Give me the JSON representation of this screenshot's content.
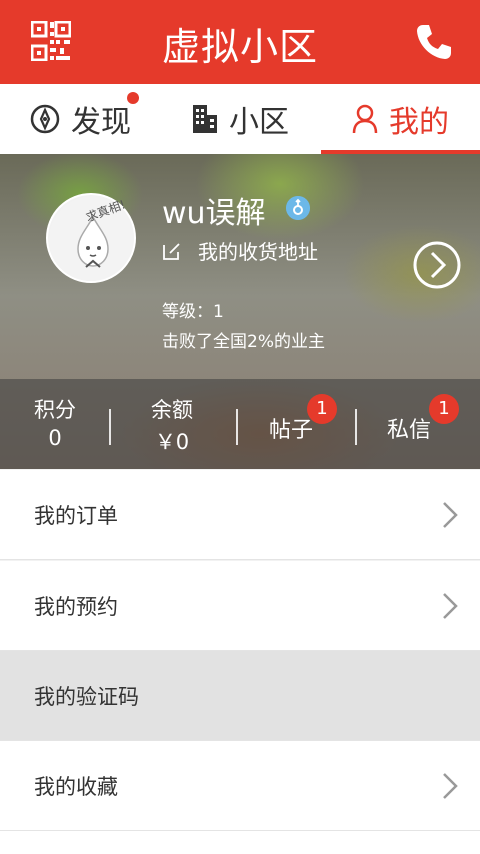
{
  "header": {
    "title": "虚拟小区",
    "left_icon": "qr-code-icon",
    "right_icon": "phone-icon"
  },
  "tabs": [
    {
      "label": "发现",
      "icon": "compass-icon",
      "has_dot": true
    },
    {
      "label": "小区",
      "icon": "building-icon"
    },
    {
      "label": "我的",
      "icon": "person-icon",
      "active": true
    }
  ],
  "profile": {
    "username": "wu误解",
    "avatar_text": "求真相!",
    "address_label": "我的收货地址",
    "level_text": "等级：1",
    "beat_text": "击败了全国2%的业主"
  },
  "stats": [
    {
      "label": "积分",
      "value": "0"
    },
    {
      "label": "余额",
      "value": "￥0"
    },
    {
      "label": "帖子",
      "badge": "1"
    },
    {
      "label": "私信",
      "badge": "1"
    }
  ],
  "menu": [
    {
      "label": "我的订单"
    },
    {
      "label": "我的预约"
    },
    {
      "label": "我的验证码"
    },
    {
      "label": "我的收藏"
    }
  ],
  "colors": {
    "accent": "#e53a2b",
    "badge": "#e53a2b",
    "gender": "#6cb8e8"
  }
}
